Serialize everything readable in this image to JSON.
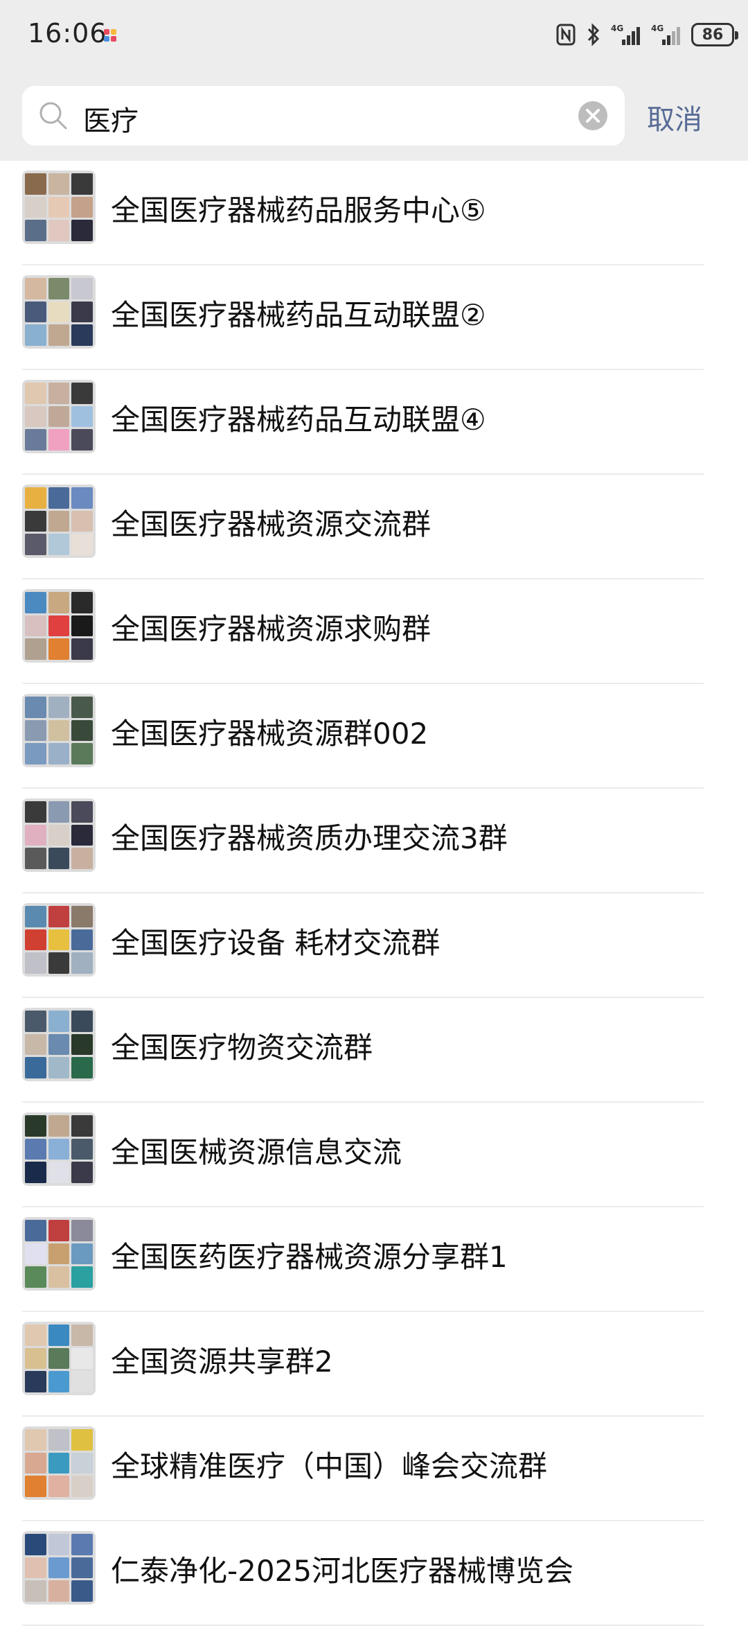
{
  "status_bar": {
    "time": "16:06",
    "network_1": "4G",
    "network_2": "4G",
    "battery": "86"
  },
  "search": {
    "query": "医疗",
    "cancel_label": "取消"
  },
  "results": [
    {
      "title": "全国医疗器械药品服务中心⑤",
      "colors": [
        "#8a6a4c",
        "#c9b4a0",
        "#3a3a3a",
        "#d8d0c8",
        "#e6c9b5",
        "#c4a18a",
        "#5a6e8a",
        "#e0c8c0",
        "#2a2a3a"
      ]
    },
    {
      "title": "全国医疗器械药品互动联盟②",
      "colors": [
        "#d4b8a0",
        "#7a8a6a",
        "#c8c8d0",
        "#4a5a7a",
        "#e8dcc0",
        "#3a3a4a",
        "#8ab0d0",
        "#c0a890",
        "#2a3a5a"
      ]
    },
    {
      "title": "全国医疗器械药品互动联盟④",
      "colors": [
        "#e0c8b0",
        "#c8b0a0",
        "#3a3a3a",
        "#d8c8c0",
        "#c0a898",
        "#a0c0e0",
        "#6a7a9a",
        "#f0a0c0",
        "#4a4a5a"
      ]
    },
    {
      "title": "全国医疗器械资源交流群",
      "colors": [
        "#e8b040",
        "#4a6a9a",
        "#6a8ac0",
        "#3a3a3a",
        "#c0a890",
        "#d8c0b0",
        "#5a5a6a",
        "#b0c8d8",
        "#e8e0d8"
      ]
    },
    {
      "title": "全国医疗器械资源求购群",
      "colors": [
        "#4a8ac0",
        "#c8a880",
        "#2a2a2a",
        "#d8c0c0",
        "#e04040",
        "#1a1a1a",
        "#b0a090",
        "#e08030",
        "#3a3a4a"
      ]
    },
    {
      "title": "全国医疗器械资源群002",
      "colors": [
        "#6a8ab0",
        "#a0b0c0",
        "#4a5a4a",
        "#8a9ab0",
        "#d0c0a0",
        "#3a4a3a",
        "#7a9ac0",
        "#9ab0c8",
        "#5a7a5a"
      ]
    },
    {
      "title": "全国医疗器械资质办理交流3群",
      "colors": [
        "#3a3a3a",
        "#8a9ab0",
        "#4a4a5a",
        "#e0b0c0",
        "#d8d0c8",
        "#2a2a3a",
        "#5a5a5a",
        "#3a4a5a",
        "#c8b0a0"
      ]
    },
    {
      "title": "全国医疗设备 耗材交流群",
      "colors": [
        "#5a8ab0",
        "#c04040",
        "#8a7a6a",
        "#d04030",
        "#e8c040",
        "#4a6a9a",
        "#c0c0c8",
        "#3a3a3a",
        "#a0b0c0"
      ]
    },
    {
      "title": "全国医疗物资交流群",
      "colors": [
        "#4a5a6a",
        "#8ab0d0",
        "#3a4a5a",
        "#c8b8a8",
        "#6a8ab0",
        "#2a3a2a",
        "#3a6a9a",
        "#a0b8c8",
        "#2a6a4a"
      ]
    },
    {
      "title": "全国医械资源信息交流",
      "colors": [
        "#2a3a2a",
        "#c0a890",
        "#3a3a3a",
        "#5a7ab0",
        "#8ab0d8",
        "#4a5a6a",
        "#1a2a4a",
        "#e0e0e8",
        "#3a3a4a"
      ]
    },
    {
      "title": "全国医药医疗器械资源分享群1",
      "colors": [
        "#4a6a9a",
        "#c04040",
        "#8a8a9a",
        "#e0e0f0",
        "#c8a070",
        "#6a9ac0",
        "#5a8a5a",
        "#d8c0a0",
        "#2aa0a0"
      ]
    },
    {
      "title": "全国资源共享群2",
      "colors": [
        "#e0c8b0",
        "#3a8ac0",
        "#c8b8a8",
        "#d8c090",
        "#5a7a5a",
        "#e8e8e8",
        "#2a3a5a",
        "#4a9ad0",
        "#e0e0e0"
      ]
    },
    {
      "title": "全球精准医疗（中国）峰会交流群",
      "colors": [
        "#e0c8b0",
        "#c0c0c8",
        "#e0c040",
        "#d8a890",
        "#3a9ac0",
        "#c8d0d8",
        "#e08030",
        "#e0b0a0",
        "#d8d0c8"
      ]
    },
    {
      "title": "仁泰净化-2025河北医疗器械博览会",
      "colors": [
        "#2a4a7a",
        "#c0c8d8",
        "#5a7ab0",
        "#e0c0b0",
        "#6a9ad0",
        "#4a6a9a",
        "#c8c0b8",
        "#d8b0a0",
        "#3a5a8a"
      ]
    }
  ]
}
